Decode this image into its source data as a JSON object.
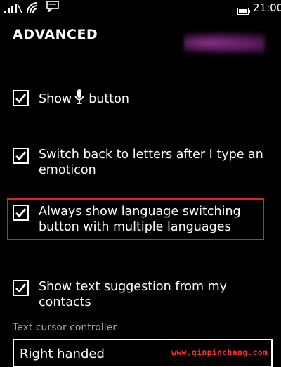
{
  "statusbar": {
    "time": "21:00",
    "icons": [
      "signal-icon",
      "wifi-icon",
      "message-icon",
      "battery-icon"
    ]
  },
  "page": {
    "title": "ADVANCED"
  },
  "options": [
    {
      "label_before": "Show",
      "icon": "microphone-icon",
      "label_after": "button",
      "checked": true
    },
    {
      "label": "Switch back to letters after I type an emoticon",
      "checked": true
    },
    {
      "label": "Always show language switching button with multiple languages",
      "checked": true,
      "highlighted": true
    },
    {
      "label": "Show text suggestion from my contacts",
      "checked": true
    }
  ],
  "text_cursor": {
    "label": "Text cursor controller",
    "value": "Right handed"
  },
  "watermark": "www.qinpinchang.com",
  "colors": {
    "background": "#000000",
    "text": "#ffffff",
    "highlight": "#e0202a",
    "watermark": "#ff2a2a"
  }
}
